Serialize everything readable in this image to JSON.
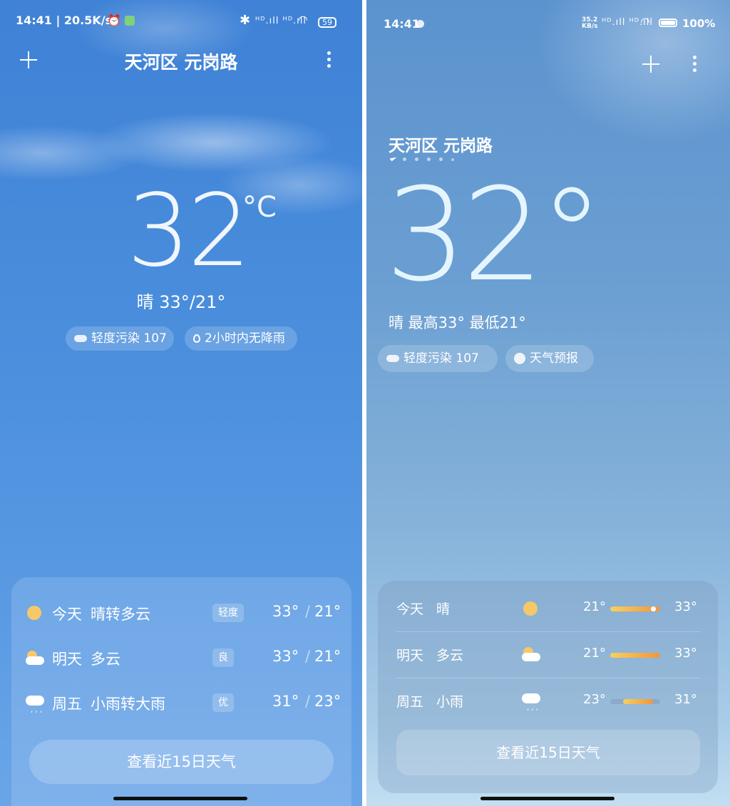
{
  "left": {
    "status": {
      "time_speed": "14:41 | 20.5K/s",
      "network": "ᴴᴰ.ıll ᴴᴰ.ıll",
      "battery": "59"
    },
    "location": "天河区 元岗路",
    "temp": {
      "value": "32",
      "unit": "°C"
    },
    "summary": "晴  33°/21°",
    "chips": [
      {
        "label": "轻度污染 107"
      },
      {
        "label": "2小时内无降雨"
      }
    ],
    "forecast": [
      {
        "day": "今天",
        "cond": "晴转多云",
        "aqi": "轻度",
        "high": "33°",
        "low": "21°",
        "icon": "sun-icon"
      },
      {
        "day": "明天",
        "cond": "多云",
        "aqi": "良",
        "high": "33°",
        "low": "21°",
        "icon": "partly-cloudy-icon"
      },
      {
        "day": "周五",
        "cond": "小雨转大雨",
        "aqi": "优",
        "high": "31°",
        "low": "23°",
        "icon": "rain-icon"
      }
    ],
    "slash": "/",
    "button": "查看近15日天气"
  },
  "right": {
    "status": {
      "time": "14:41",
      "speed": "35.2 KB/s",
      "network": "ᴴᴰ.ıll ᴴᴰ.ıll",
      "battery": "100%"
    },
    "location": "天河区 元岗路",
    "temp": "32°",
    "summary": "晴  最高33° 最低21°",
    "chips": [
      {
        "label": "轻度污染 107"
      },
      {
        "label": "天气预报"
      }
    ],
    "forecast": [
      {
        "day": "今天",
        "cond": "晴",
        "low": "21°",
        "high": "33°",
        "icon": "sun-icon",
        "bar_start": 0.0,
        "bar_end": 1.0,
        "current": 0.85
      },
      {
        "day": "明天",
        "cond": "多云",
        "low": "21°",
        "high": "33°",
        "icon": "partly-cloudy-icon",
        "bar_start": 0.0,
        "bar_end": 1.0
      },
      {
        "day": "周五",
        "cond": "小雨",
        "low": "23°",
        "high": "31°",
        "icon": "rain-icon",
        "bar_start": 0.25,
        "bar_end": 0.85
      }
    ],
    "button": "查看近15日天气"
  }
}
